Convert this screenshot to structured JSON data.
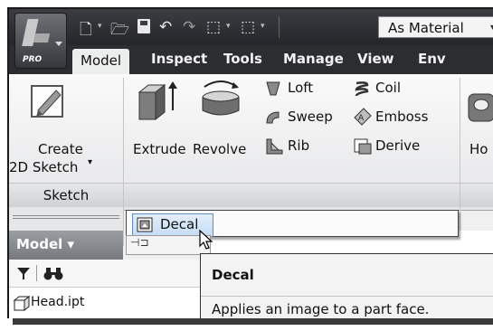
{
  "app": {
    "edition_label": "PRO",
    "quick_access": {
      "icons": [
        "new-icon",
        "open-icon",
        "save-icon",
        "undo-icon",
        "redo-icon",
        "appearance-icon",
        "select-icon"
      ],
      "material_dropdown_value": "As Material"
    }
  },
  "tabs": [
    {
      "label": "Model",
      "active": true
    },
    {
      "label": "Inspect"
    },
    {
      "label": "Tools"
    },
    {
      "label": "Manage"
    },
    {
      "label": "View"
    },
    {
      "label": "Env"
    }
  ],
  "ribbon": {
    "sketch_panel": {
      "create_label_line1": "Create",
      "create_label_line2": "2D Sketch",
      "title": "Sketch"
    },
    "create_panel": {
      "extrude": "Extrude",
      "revolve": "Revolve",
      "loft": "Loft",
      "sweep": "Sweep",
      "rib": "Rib",
      "coil": "Coil",
      "emboss": "Emboss",
      "derive": "Derive",
      "hole_partial": "Ho"
    }
  },
  "browser": {
    "header_label": "Model ▾",
    "filter_icon": "filter-icon",
    "find_icon": "binoculars-icon",
    "root_item": "Head.ipt"
  },
  "overflow_menu": {
    "decal_label": "Decal",
    "pin_icon": "pin-icon"
  },
  "tooltip": {
    "title": "Decal",
    "description": "Applies an image to a part face."
  },
  "colors": {
    "tab_bar": "#2b2d31",
    "highlight": "#c5dcf4",
    "highlight_border": "#5b8fc8"
  }
}
